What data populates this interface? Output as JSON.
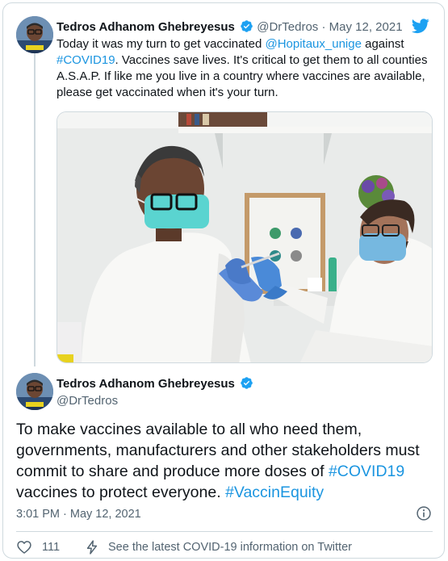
{
  "colors": {
    "brand_blue": "#1da1f2",
    "link_blue": "#1b95e0",
    "text_primary": "#0f1419",
    "text_secondary": "#536471",
    "border": "#cfd9de"
  },
  "icons": {
    "logo": "twitter-bird-icon",
    "verified": "verified-badge-icon",
    "info": "info-circle-icon",
    "like": "heart-icon",
    "covid_info": "lightning-bolt-icon"
  },
  "tweet1": {
    "author_name": "Tedros Adhanom Ghebreyesus",
    "handle": "@DrTedros",
    "separator": "·",
    "date": "May 12, 2021",
    "text_1": "Today it was my turn to get vaccinated ",
    "mention": "@Hopitaux_unige",
    "text_2": " against ",
    "hashtag": "#COVID19",
    "text_3": ". Vaccines save lives. It's critical to get them to all counties A.S.A.P. If like me you live in a country where vaccines are available, please get vaccinated when it's your turn."
  },
  "tweet2": {
    "author_name": "Tedros Adhanom Ghebreyesus",
    "handle": "@DrTedros",
    "text_1": "To make vaccines available to all who need them, governments, manufacturers and other stakeholders must commit to share and produce more doses of ",
    "hashtag_1": "#COVID19",
    "text_2": " vaccines to protect everyone. ",
    "hashtag_2": "#VaccinEquity",
    "timestamp": "3:01 PM · May 12, 2021",
    "like_count": "111",
    "info_link": "See the latest COVID-19 information on Twitter"
  }
}
